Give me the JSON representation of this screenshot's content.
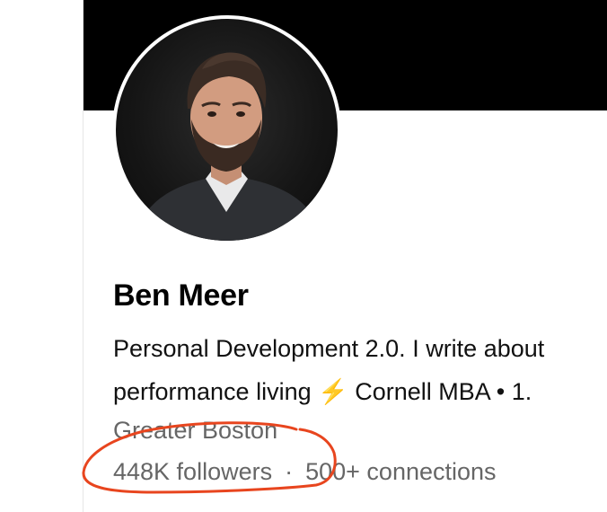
{
  "profile": {
    "name": "Ben Meer",
    "headline_line1": "Personal Development 2.0. I write about",
    "headline_line2_pre": "performance living ",
    "headline_line2_icon": "lightning-icon",
    "headline_line2_bolt": "⚡",
    "headline_line2_post": " Cornell MBA • 1.",
    "location": "Greater Boston",
    "followers": "448K followers",
    "separator": "·",
    "connections": "500+ connections"
  },
  "colors": {
    "cover": "#000000",
    "annotation": "#e8451e",
    "muted_text": "#666666"
  }
}
